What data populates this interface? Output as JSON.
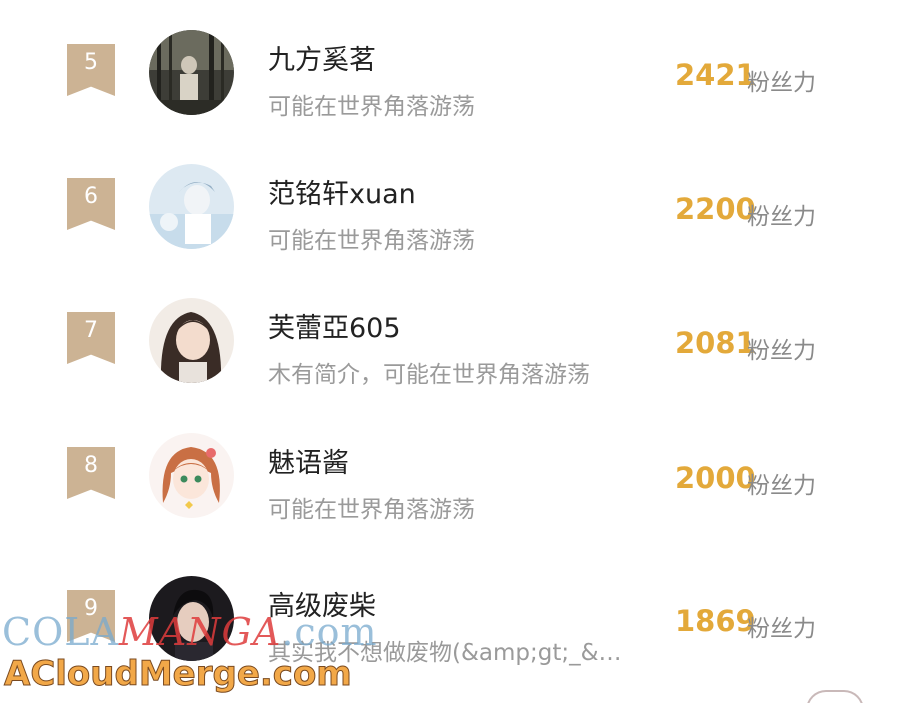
{
  "ranking": [
    {
      "rank": "5",
      "name": "九方奚茗",
      "bio": "可能在世界角落游荡",
      "score": "2421",
      "score_label": "粉丝力",
      "avatar_icon": "dark-forest-portrait-avatar"
    },
    {
      "rank": "6",
      "name": "范铭轩xuan",
      "bio": "可能在世界角落游荡",
      "score": "2200",
      "score_label": "粉丝力",
      "avatar_icon": "pale-blue-anime-avatar"
    },
    {
      "rank": "7",
      "name": "芙蕾亞605",
      "bio": "木有简介，可能在世界角落游荡",
      "score": "2081",
      "score_label": "粉丝力",
      "avatar_icon": "girl-selfie-avatar"
    },
    {
      "rank": "8",
      "name": "魅语酱",
      "bio": "可能在世界角落游荡",
      "score": "2000",
      "score_label": "粉丝力",
      "avatar_icon": "anime-girl-brown-hair-avatar"
    },
    {
      "rank": "9",
      "name": "高级废柴",
      "bio": "其实我不想做废物(&amp;gt;_&…",
      "score": "1869",
      "score_label": "粉丝力",
      "avatar_icon": "dark-hair-man-avatar"
    }
  ],
  "watermark": {
    "line1_a": "COLA",
    "line1_b": "MANGA",
    "line1_c": ".com",
    "line2": "ACloudMerge.com"
  },
  "colors": {
    "badge": "#ccb394",
    "score": "#e3a93a",
    "name": "#222222",
    "bio": "#9a9a9a"
  }
}
